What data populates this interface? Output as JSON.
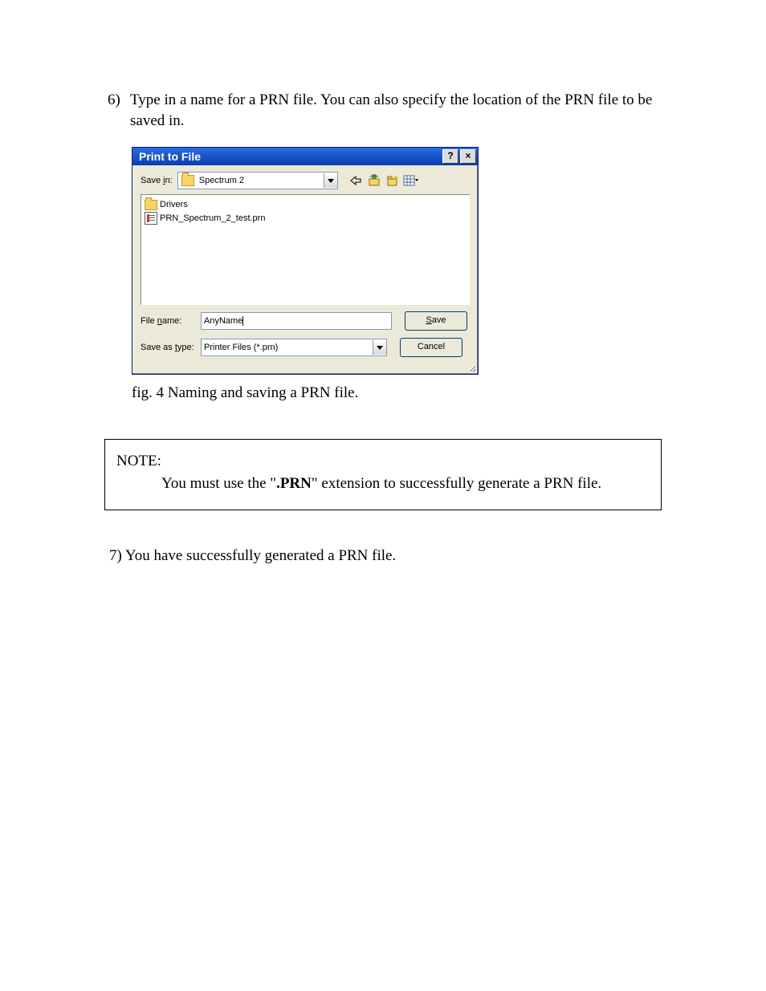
{
  "step6": {
    "num": "6)",
    "text": "Type in a name for a PRN file.  You can also specify the location of the PRN file to be saved in."
  },
  "dialog": {
    "title": "Print to File",
    "help_label": "?",
    "close_label": "×",
    "save_in_label_pre": "Save ",
    "save_in_label_ul": "i",
    "save_in_label_post": "n:",
    "location": "Spectrum 2",
    "files": {
      "folder": "Drivers",
      "prn": "PRN_Spectrum_2_test.prn"
    },
    "filename_label_pre": "File ",
    "filename_label_ul": "n",
    "filename_label_post": "ame:",
    "filename_value": "AnyName",
    "type_label_pre": "Save as ",
    "type_label_ul": "t",
    "type_label_post": "ype:",
    "type_value": "Printer Files (*.prn)",
    "save_btn_ul": "S",
    "save_btn_post": "ave",
    "cancel_btn": "Cancel"
  },
  "caption": "fig. 4  Naming and saving a PRN file.",
  "note": {
    "title": "NOTE:",
    "pre": "You must use the \"",
    "bold": ".PRN",
    "post": "\" extension to successfully generate a PRN file."
  },
  "step7": "7) You have successfully generated a PRN file."
}
